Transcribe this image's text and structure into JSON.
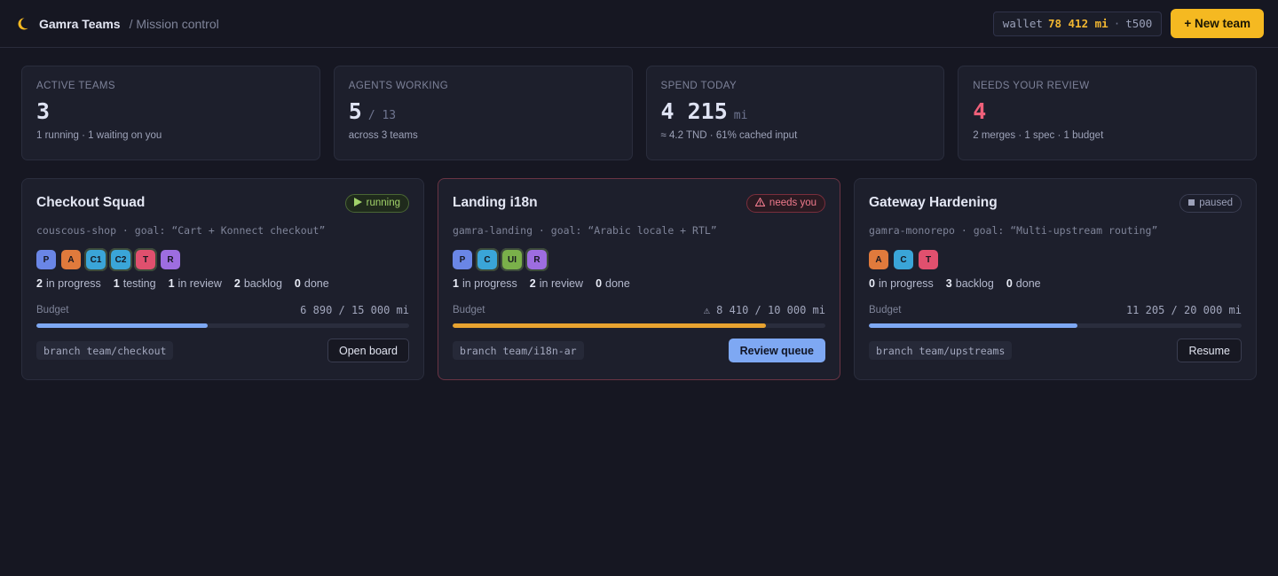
{
  "header": {
    "app_name": "Gamra Teams",
    "crumb": "/ Mission control",
    "wallet_label": "wallet",
    "wallet_amount": "78 412 mi",
    "wallet_sep": "·",
    "wallet_tier": "t500",
    "new_team_label": "+ New team",
    "logo_icon": "moon-icon"
  },
  "stats": [
    {
      "label": "Active teams",
      "value": "3",
      "unit": "",
      "sub": "1 running · 1 waiting on you"
    },
    {
      "label": "Agents working",
      "value": "5",
      "unit": "/ 13",
      "sub": "across 3 teams"
    },
    {
      "label": "Spend today",
      "value": "4 215",
      "unit": "mi",
      "sub": "≈ 4.2 TND · 61% cached input"
    },
    {
      "label": "Needs your review",
      "value": "4",
      "unit": "",
      "sub": "2 merges · 1 spec · 1 budget"
    }
  ],
  "teams": [
    {
      "title": "Checkout Squad",
      "status": "running",
      "status_icon": "play-icon",
      "goal": "couscous-shop · goal: “Cart + Konnect checkout”",
      "agents": [
        {
          "label": "P",
          "color": "#6a86e6",
          "active": false
        },
        {
          "label": "A",
          "color": "#e07a3c",
          "active": false
        },
        {
          "label": "C1",
          "color": "#3aa5d8",
          "active": true
        },
        {
          "label": "C2",
          "color": "#3aa5d8",
          "active": true
        },
        {
          "label": "T",
          "color": "#e0506e",
          "active": true
        },
        {
          "label": "R",
          "color": "#9d6de0",
          "active": false
        }
      ],
      "counts": [
        {
          "n": "2",
          "label": "in progress"
        },
        {
          "n": "1",
          "label": "testing"
        },
        {
          "n": "1",
          "label": "in review"
        },
        {
          "n": "2",
          "label": "backlog"
        },
        {
          "n": "0",
          "label": "done"
        }
      ],
      "budget_label": "Budget",
      "budget_text": "6 890 / 15 000 mi",
      "budget_fraction": 0.4593,
      "budget_color": "#7ea8f3",
      "branch": "branch team/checkout",
      "action": "Open board"
    },
    {
      "title": "Landing i18n",
      "status": "needs you",
      "status_icon": "warning-icon",
      "goal": "gamra-landing · goal: “Arabic locale + RTL”",
      "agents": [
        {
          "label": "P",
          "color": "#6a86e6",
          "active": false
        },
        {
          "label": "C",
          "color": "#3aa5d8",
          "active": true
        },
        {
          "label": "UI",
          "color": "#7ab04a",
          "active": true
        },
        {
          "label": "R",
          "color": "#9d6de0",
          "active": true
        }
      ],
      "counts": [
        {
          "n": "1",
          "label": "in progress"
        },
        {
          "n": "2",
          "label": "in review"
        },
        {
          "n": "0",
          "label": "done"
        }
      ],
      "budget_label": "Budget",
      "budget_text": "⚠ 8 410 / 10 000 mi",
      "budget_fraction": 0.841,
      "budget_color": "#e8a330",
      "branch": "branch team/i18n-ar",
      "action": "Review queue"
    },
    {
      "title": "Gateway Hardening",
      "status": "paused",
      "status_icon": "stop-icon",
      "goal": "gamra-monorepo · goal: “Multi-upstream routing”",
      "agents": [
        {
          "label": "A",
          "color": "#e07a3c",
          "active": false
        },
        {
          "label": "C",
          "color": "#3aa5d8",
          "active": false
        },
        {
          "label": "T",
          "color": "#e0506e",
          "active": false
        }
      ],
      "counts": [
        {
          "n": "0",
          "label": "in progress"
        },
        {
          "n": "3",
          "label": "backlog"
        },
        {
          "n": "0",
          "label": "done"
        }
      ],
      "budget_label": "Budget",
      "budget_text": "11 205 / 20 000 mi",
      "budget_fraction": 0.5603,
      "budget_color": "#7ea8f3",
      "branch": "branch team/upstreams",
      "action": "Resume"
    }
  ]
}
